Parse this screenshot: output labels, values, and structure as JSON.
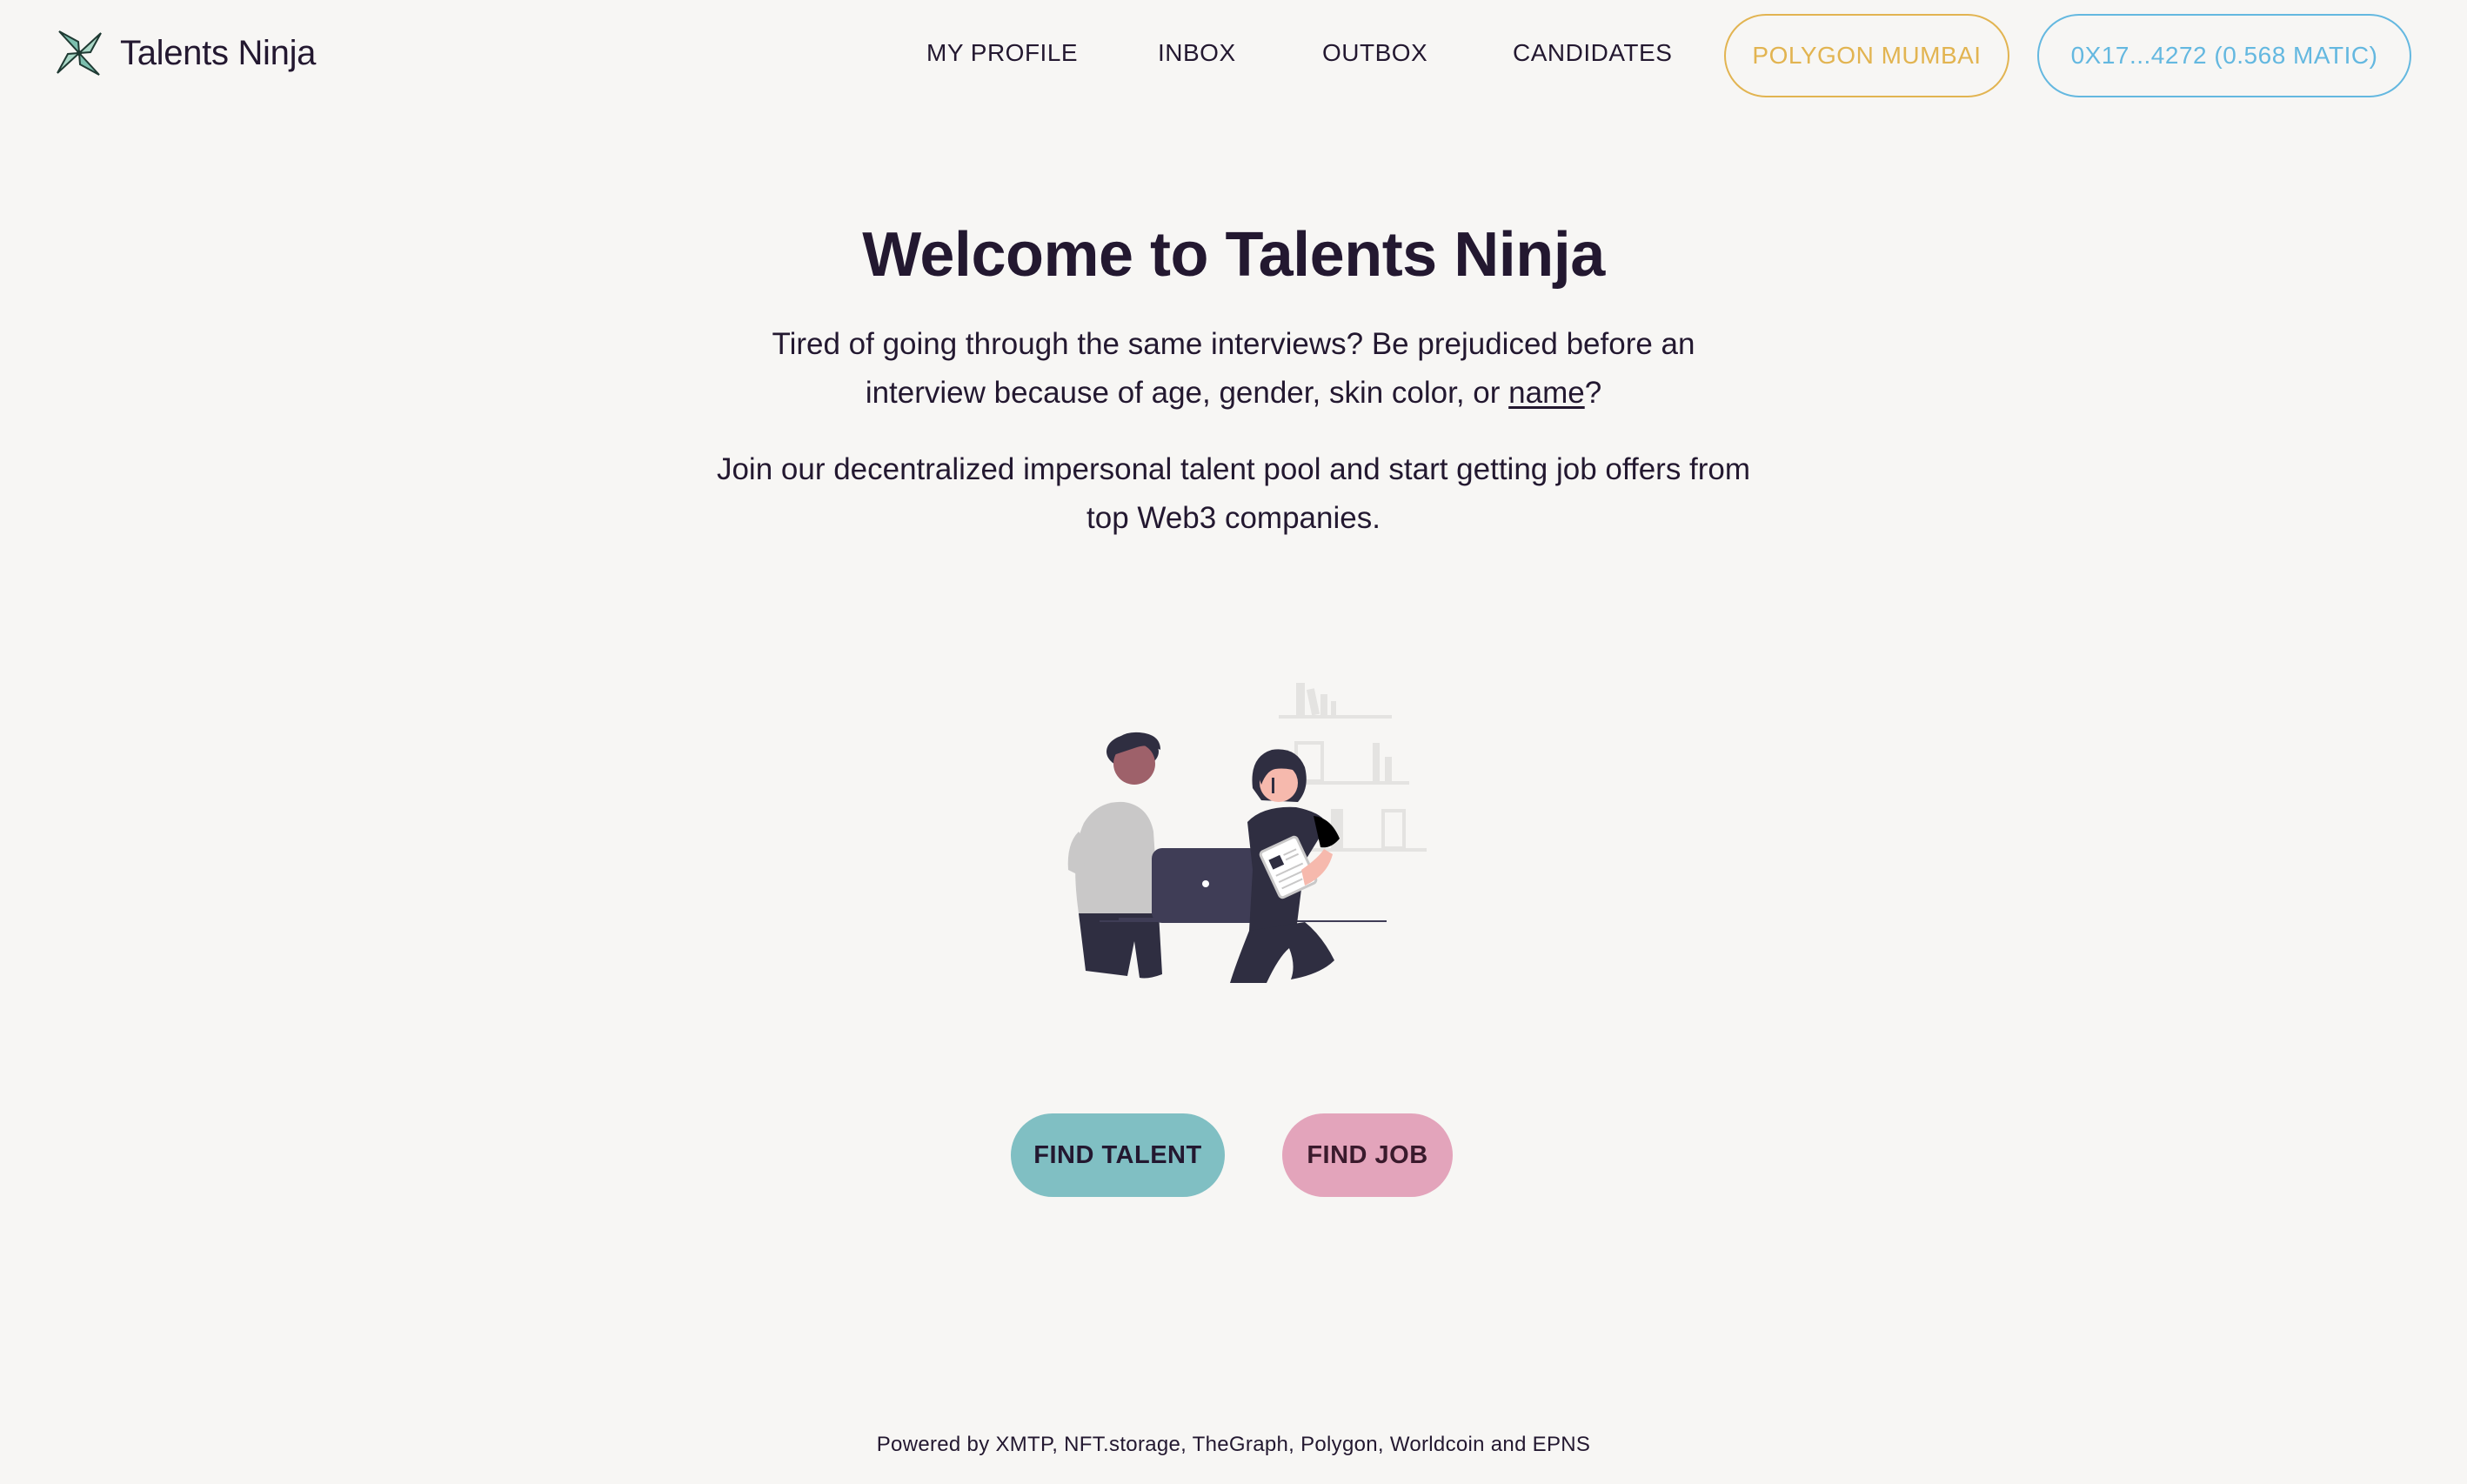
{
  "brand": {
    "name": "Talents Ninja",
    "logo_icon": "shuriken-logo-icon"
  },
  "nav": {
    "items": [
      {
        "label": "MY PROFILE"
      },
      {
        "label": "INBOX"
      },
      {
        "label": "OUTBOX"
      },
      {
        "label": "CANDIDATES"
      }
    ],
    "network_label": "POLYGON MUMBAI",
    "wallet_label": "0X17...4272 (0.568 MATIC)"
  },
  "hero": {
    "title": "Welcome to Talents Ninja",
    "intro_before_link": "Tired of going through the same interviews? Be prejudiced before an interview because of age, gender, skin color, or ",
    "intro_link": "name",
    "intro_after_link": "?",
    "pitch": "Join our decentralized impersonal talent pool and start getting job offers from top Web3 companies."
  },
  "actions": {
    "find_talent": "FIND TALENT",
    "find_job": "FIND JOB"
  },
  "footer": {
    "text": "Powered by XMTP, NFT.storage, TheGraph, Polygon, Worldcoin and EPNS"
  },
  "colors": {
    "background": "#f7f6f4",
    "text": "#231830",
    "network_accent": "#e2b451",
    "wallet_accent": "#64b8e0",
    "find_talent_bg": "#80bfc3",
    "find_job_bg": "#e3a4bb"
  }
}
